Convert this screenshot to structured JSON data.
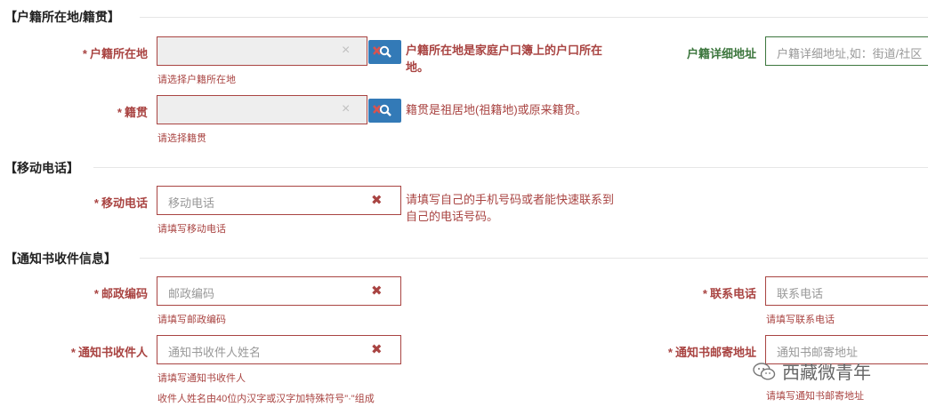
{
  "sections": {
    "household": "【户籍所在地/籍贯】",
    "mobile": "【移动电话】",
    "notice": "【通知书收件信息】"
  },
  "household_location": {
    "required": "*",
    "label": "户籍所在地",
    "clear": "×",
    "help": "请选择户籍所在地",
    "note": "户籍所在地是家庭户口簿上的户口所在地。"
  },
  "native_place": {
    "required": "*",
    "label": "籍贯",
    "clear": "×",
    "help": "请选择籍贯",
    "note": "籍贯是祖居地(祖籍地)或原来籍贯。"
  },
  "household_address": {
    "label": "户籍详细地址",
    "placeholder": "户籍详细地址,如：街道/社区"
  },
  "mobile_phone": {
    "required": "*",
    "label": "移动电话",
    "placeholder": "移动电话",
    "help": "请填写移动电话",
    "note": "请填写自己的手机号码或者能快速联系到自己的电话号码。"
  },
  "postal_code": {
    "required": "*",
    "label": "邮政编码",
    "placeholder": "邮政编码",
    "help": "请填写邮政编码"
  },
  "contact_phone": {
    "required": "*",
    "label": "联系电话",
    "placeholder": "联系电话",
    "help": "请填写联系电话"
  },
  "recipient": {
    "required": "*",
    "label": "通知书收件人",
    "placeholder": "通知书收件人姓名",
    "help": "请填写通知书收件人",
    "help2": "收件人姓名由40位内汉字或汉字加特殊符号\"·\"组成"
  },
  "mail_address": {
    "required": "*",
    "label": "通知书邮寄地址",
    "placeholder": "通知书邮寄地址",
    "help": "请填写通知书邮寄地址"
  },
  "watermark": "西藏微青年",
  "colors": {
    "error": "#a94442",
    "success": "#3c763d",
    "button": "#337ab7",
    "disabled": "#eeeeee"
  },
  "icons": {
    "search": "search-icon",
    "clear": "clear-icon",
    "error": "error-x-icon",
    "wechat": "wechat-icon"
  }
}
